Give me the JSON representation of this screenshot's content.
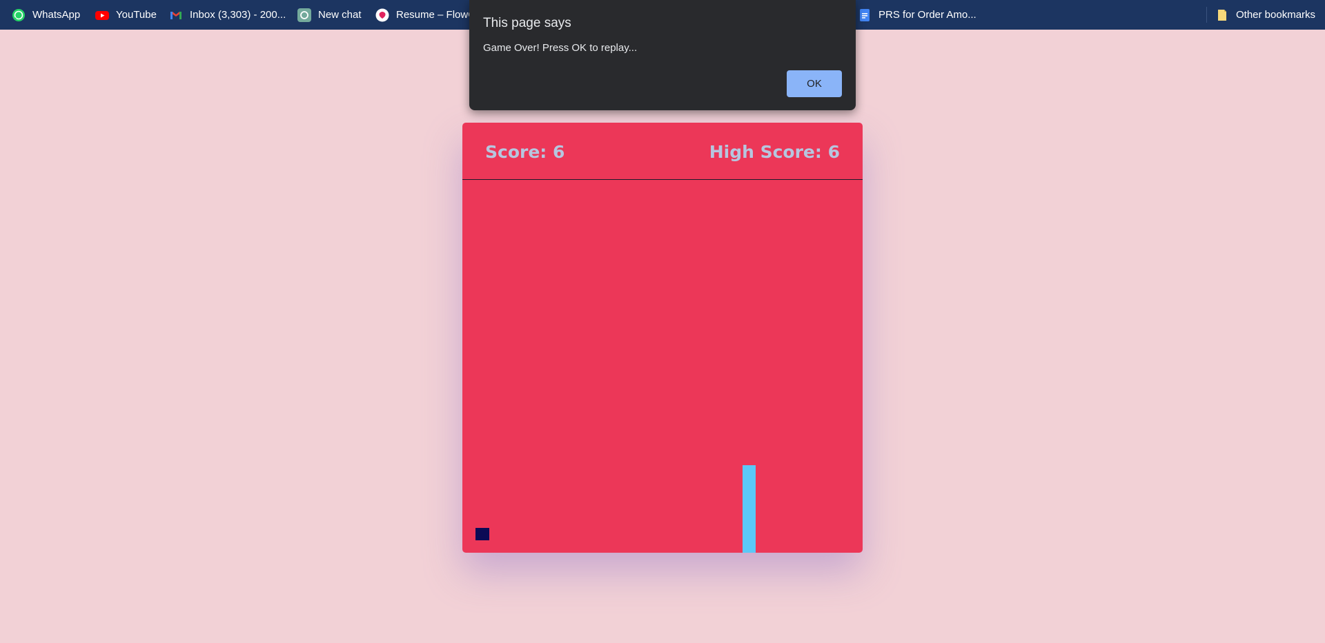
{
  "bookmarks": {
    "items": [
      {
        "label": "WhatsApp",
        "icon": "whatsapp-icon"
      },
      {
        "label": "YouTube",
        "icon": "youtube-icon"
      },
      {
        "label": "Inbox (3,303) - 200...",
        "icon": "gmail-icon"
      },
      {
        "label": "New chat",
        "icon": "chatgpt-icon"
      },
      {
        "label": "Resume – FlowC",
        "icon": "flowcv-icon"
      },
      {
        "label": "PRS for Order Amo...",
        "icon": "google-docs-icon"
      }
    ],
    "other": {
      "label": "Other bookmarks",
      "icon": "folder-icon"
    }
  },
  "dialog": {
    "title": "This page says",
    "message": "Game Over! Press OK to replay...",
    "ok_label": "OK"
  },
  "game": {
    "score_text": "Score: 6",
    "high_score_text": "High Score: 6",
    "colors": {
      "board": "#ec3758",
      "player": "#0b0a55",
      "obstacle": "#5bc8f7",
      "header_text": "#b6c6df"
    }
  }
}
